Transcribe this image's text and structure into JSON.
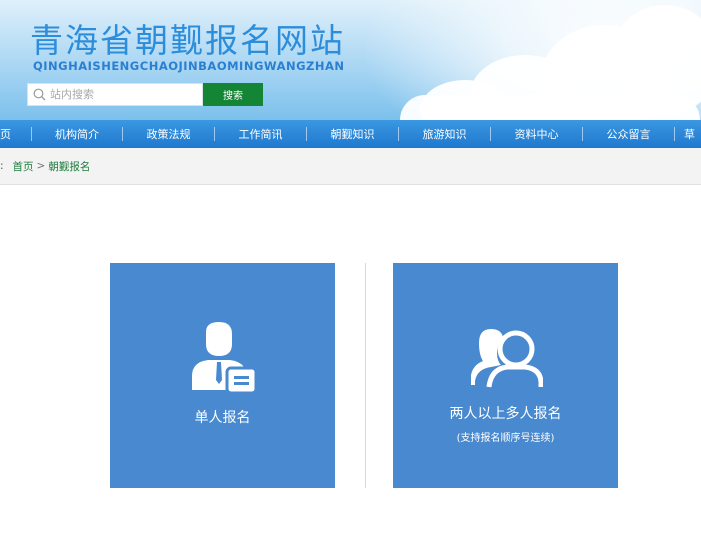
{
  "header": {
    "title": "青海省朝觐报名网站",
    "subtitle": "QINGHAISHENGCHAOJINBAOMINGWANGZHAN",
    "search_placeholder": "站内搜索",
    "search_button": "搜索"
  },
  "nav": {
    "items": [
      "页",
      "机构简介",
      "政策法规",
      "工作简讯",
      "朝觐知识",
      "旅游知识",
      "资料中心",
      "公众留言",
      "草"
    ]
  },
  "breadcrumb": {
    "prefix": ":",
    "home": "首页",
    "separator": ">",
    "current": "朝觐报名"
  },
  "cards": {
    "single": {
      "title": "单人报名"
    },
    "group": {
      "title": "两人以上多人报名",
      "subtitle": "(支持报名顺序号连续)"
    }
  },
  "colors": {
    "nav": "#2a87d8",
    "card": "#4889cf",
    "search_button": "#138535",
    "link": "#1f7e3d"
  }
}
